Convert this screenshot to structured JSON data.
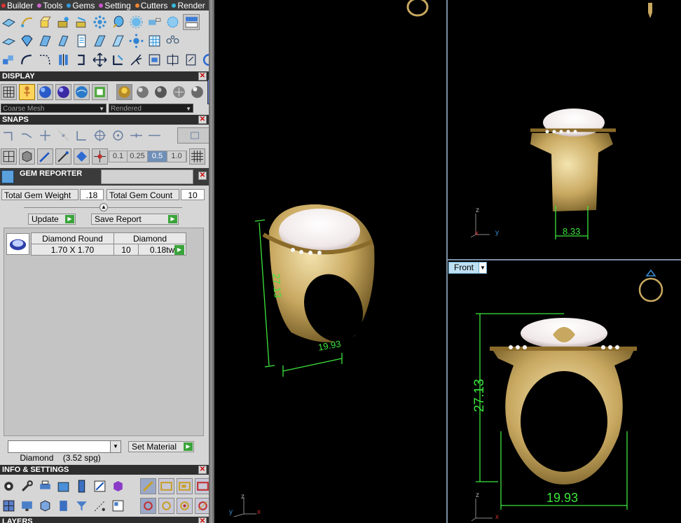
{
  "menubar": [
    {
      "label": "Builder",
      "dot": "#d33"
    },
    {
      "label": "Tools",
      "dot": "#c6c"
    },
    {
      "label": "Gems",
      "dot": "#39d"
    },
    {
      "label": "Setting",
      "dot": "#c5c"
    },
    {
      "label": "Cutters",
      "dot": "#e83"
    },
    {
      "label": "Render",
      "dot": "#3bd"
    }
  ],
  "sections": {
    "display": "DISPLAY",
    "snaps": "SNAPS",
    "info": "INFO & SETTINGS",
    "layers": "LAYERS"
  },
  "display": {
    "mesh_select": "Coarse Mesh",
    "render_select": "Rendered"
  },
  "snaps": {
    "values": [
      "0.1",
      "0.25",
      "0.5",
      "1.0"
    ],
    "selected_index": 2
  },
  "gem_reporter": {
    "title": "GEM REPORTER",
    "weight_label": "Total Gem Weight",
    "weight_value": ".18",
    "count_label": "Total Gem Count",
    "count_value": "10",
    "update_label": "Update",
    "save_label": "Save Report",
    "table": {
      "shape": "Diamond Round",
      "material": "Diamond",
      "size": "1.70 X 1.70",
      "count": "10",
      "weight": "0.18tw"
    },
    "material_select": "Diamond    (3.52 spg)",
    "set_material_label": "Set Material"
  },
  "viewports": {
    "front_tab": "Front",
    "perspective_dims": {
      "height": "27.13",
      "width": "19.93"
    },
    "side_dims": {
      "width": "8.33"
    },
    "front_dims": {
      "height": "27.13",
      "width": "19.93"
    }
  },
  "axes": {
    "x": "x",
    "y": "y",
    "z": "z"
  },
  "colors": {
    "dimension_green": "#3ce53c",
    "gold": "#c8a860",
    "pearl": "#f0e8e8",
    "accent_blue": "#6f8fb7"
  }
}
